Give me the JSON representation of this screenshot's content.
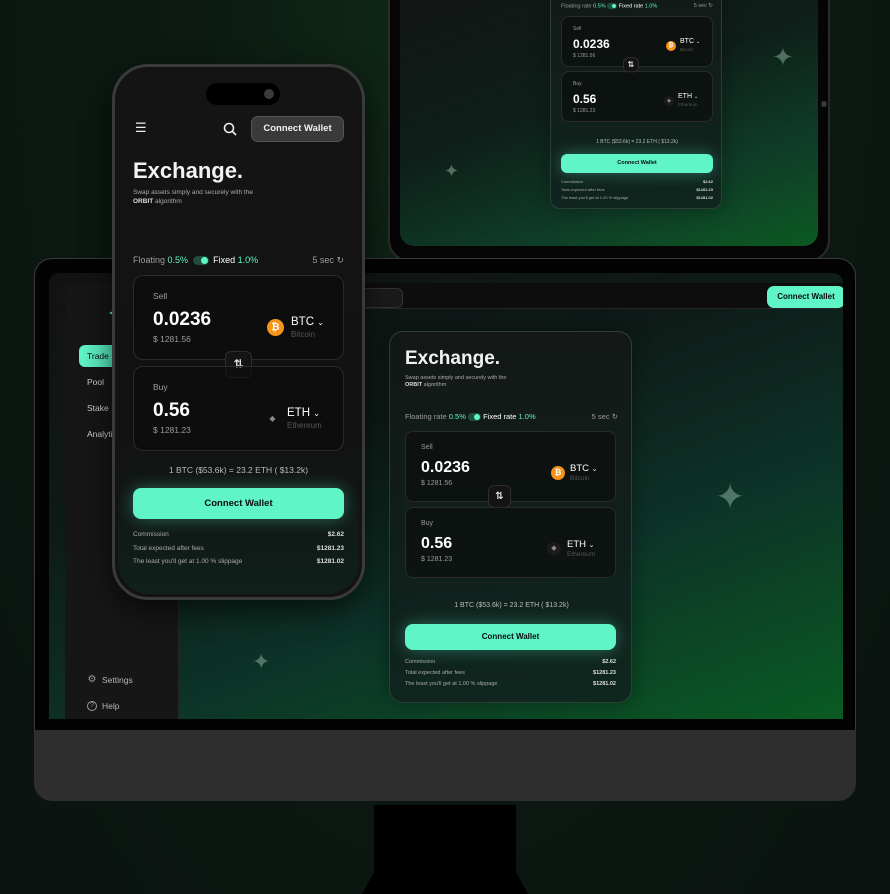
{
  "brand": {
    "accent_color": "#5ff5c6",
    "btc_color": "#f7931a"
  },
  "exchange": {
    "title": "Exchange.",
    "subtitle_line1": "Swap assets simply and securely with the",
    "subtitle_brand": "ORBIT",
    "subtitle_line2": "algorithm",
    "refresh": "5 sec",
    "sell": {
      "label": "Sell",
      "amount": "0.0236",
      "usd": "$ 1281.56",
      "token": "BTC",
      "token_name": "Bitcoin"
    },
    "buy": {
      "label": "Buy",
      "amount": "0.56",
      "usd": "$ 1281.23",
      "token": "ETH",
      "token_name": "Ethereum"
    },
    "rate": "1 BTC ($53.6k) = 23.2 ETH ( $13.2k)",
    "cta": "Connect Wallet",
    "fees": [
      {
        "label": "Commission",
        "value": "$2.62"
      },
      {
        "label": "Total expected after fees",
        "value": "$1281.23"
      },
      {
        "label": "The least you'll get at 1.00 % slippage",
        "value": "$1281.02"
      }
    ]
  },
  "desktop_rate": {
    "floating_label": "Floating rate",
    "floating_value": "0.5%",
    "fixed_label": "Fixed rate",
    "fixed_value": "1.0%"
  },
  "mobile_rate": {
    "floating_label": "Floating",
    "floating_value": "0.5%",
    "fixed_label": "Fixed",
    "fixed_value": "1.0%"
  },
  "sidebar": {
    "items": [
      {
        "label": "Trade",
        "active": true
      },
      {
        "label": "Pool"
      },
      {
        "label": "Stake"
      },
      {
        "label": "Analytics"
      }
    ],
    "settings": "Settings",
    "help": "Help"
  },
  "header": {
    "connect_wallet": "Connect Wallet"
  },
  "icons": {
    "menu": "☰",
    "search": "⚲",
    "swap": "⇅",
    "chevron": "⌄",
    "refresh": "↻",
    "btc": "₿",
    "eth": "◆",
    "gear": "⚙",
    "help": "?",
    "sparkle": "✦"
  }
}
